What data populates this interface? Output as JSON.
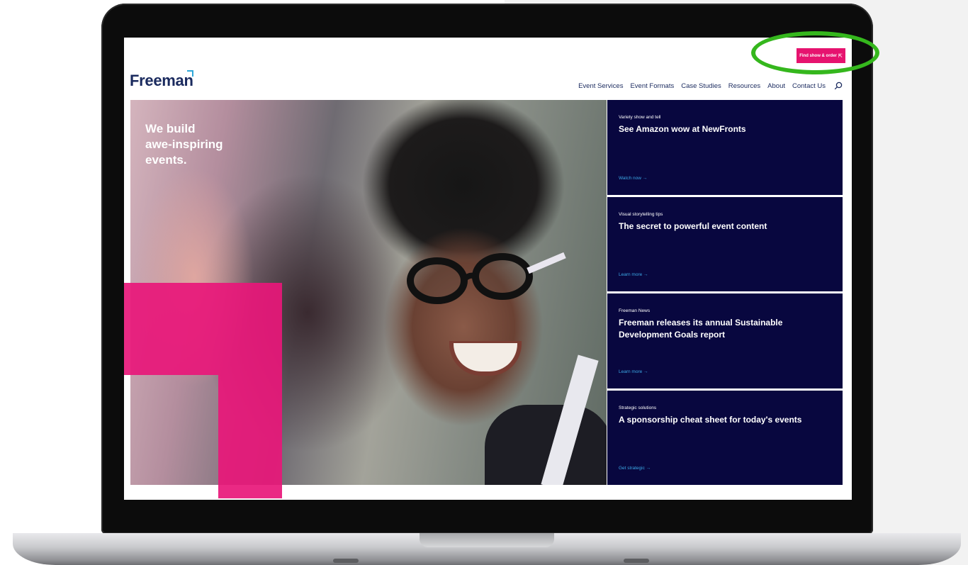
{
  "header": {
    "find_show_button": "Find show & order",
    "logo": "Freeman",
    "nav": [
      "Event Services",
      "Event Formats",
      "Case Studies",
      "Resources",
      "About",
      "Contact Us"
    ]
  },
  "hero": {
    "title_lines": [
      "We build",
      "awe-inspiring",
      "events."
    ]
  },
  "cards": [
    {
      "category": "Variety show and tell",
      "title": "See Amazon wow at NewFronts",
      "cta": "Watch now →"
    },
    {
      "category": "Visual storytelling tips",
      "title": "The secret to powerful event content",
      "cta": "Learn more →"
    },
    {
      "category": "Freeman News",
      "title": "Freeman releases its annual Sustainable Development Goals report",
      "cta": "Learn more →"
    },
    {
      "category": "Strategic solutions",
      "title": "A sponsorship cheat sheet for today's events",
      "cta": "Get strategic →"
    }
  ],
  "colors": {
    "brand_navy": "#1a2a5e",
    "card_bg": "#08073f",
    "accent_pink": "#e6136f",
    "highlight_green": "#35b71d",
    "link_blue": "#3ba8e6"
  }
}
